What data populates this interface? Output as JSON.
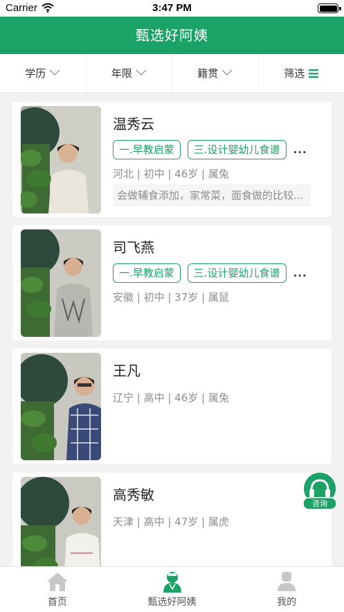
{
  "status_bar": {
    "carrier": "Carrier",
    "time": "3:47 PM",
    "battery_level": 1.0
  },
  "header": {
    "title": "甄选好阿姨"
  },
  "filters": [
    {
      "label": "学历",
      "icon": "chevron-down-icon"
    },
    {
      "label": "年限",
      "icon": "chevron-down-icon"
    },
    {
      "label": "籍贯",
      "icon": "chevron-down-icon"
    },
    {
      "label": "筛选",
      "icon": "menu-icon"
    }
  ],
  "caregivers": [
    {
      "name": "温秀云",
      "tags": [
        "一.早教启蒙",
        "三.设计婴幼儿食谱"
      ],
      "more": "...",
      "info": "河北 | 初中 | 46岁 | 属兔",
      "description": "会做辅食添加，家常菜，面食做的比较..."
    },
    {
      "name": "司飞燕",
      "tags": [
        "一.早教启蒙",
        "三.设计婴幼儿食谱"
      ],
      "more": "...",
      "info": "安徽 | 初中 | 37岁 | 属鼠"
    },
    {
      "name": "王凡",
      "info": "辽宁 | 高中 | 46岁 | 属兔"
    },
    {
      "name": "高秀敏",
      "info": "天津 | 高中 | 47岁 | 属虎"
    }
  ],
  "consult_button": {
    "label": "咨询"
  },
  "tab_bar": [
    {
      "label": "首页",
      "icon": "home-icon",
      "active": false
    },
    {
      "label": "甄选好阿姨",
      "icon": "nanny-icon",
      "active": true
    },
    {
      "label": "我的",
      "icon": "profile-icon",
      "active": false
    }
  ],
  "colors": {
    "brand_green": "#1aa267",
    "tab_inactive": "#c8c8c8",
    "background": "#f2f2f2"
  }
}
